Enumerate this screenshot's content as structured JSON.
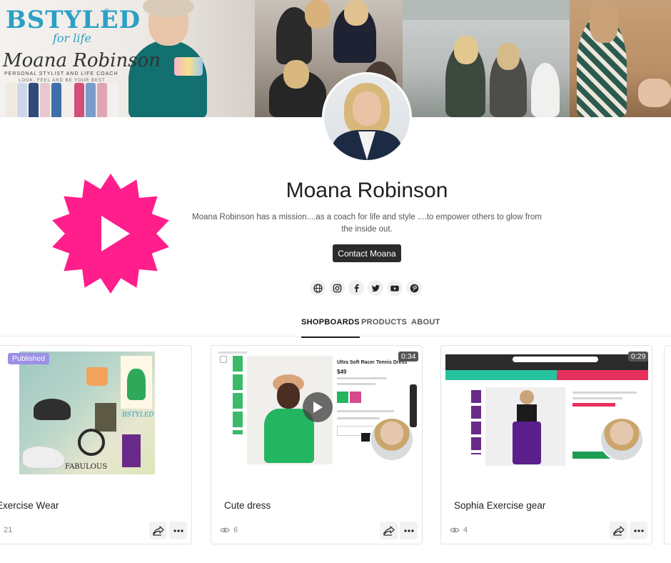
{
  "banner": {
    "logo": "BSTYLED",
    "logo_sub": "for life",
    "logo_reg": "®",
    "script_name": "Moana Robinson",
    "tagline": "PERSONAL STYLIST AND LIFE COACH",
    "tagline2": "LOOK, FEEL AND BE YOUR BEST"
  },
  "profile": {
    "name": "Moana Robinson",
    "bio": "Moana Robinson has a mission....as a coach for life and style ....to empower others to glow from the inside out.",
    "contact_label": "Contact Moana"
  },
  "socials": [
    "globe-icon",
    "instagram-icon",
    "facebook-icon",
    "twitter-icon",
    "youtube-icon",
    "pinterest-icon"
  ],
  "tabs": [
    {
      "label": "SHOPBOARDS",
      "active": true
    },
    {
      "label": "PRODUCTS",
      "active": false
    },
    {
      "label": "ABOUT",
      "active": false
    }
  ],
  "cards": [
    {
      "title": "Exercise Wear",
      "views": "21",
      "badge": "Published",
      "duration": ""
    },
    {
      "title": "Cute dress",
      "views": "6",
      "badge": "",
      "duration": "0:34"
    },
    {
      "title": "Sophia Exercise gear",
      "views": "4",
      "badge": "",
      "duration": "0:29"
    }
  ],
  "colors": {
    "accent_pink": "#ff1e8c",
    "button_dark": "#2b2b2b",
    "published_badge": "#9b8fe6"
  }
}
